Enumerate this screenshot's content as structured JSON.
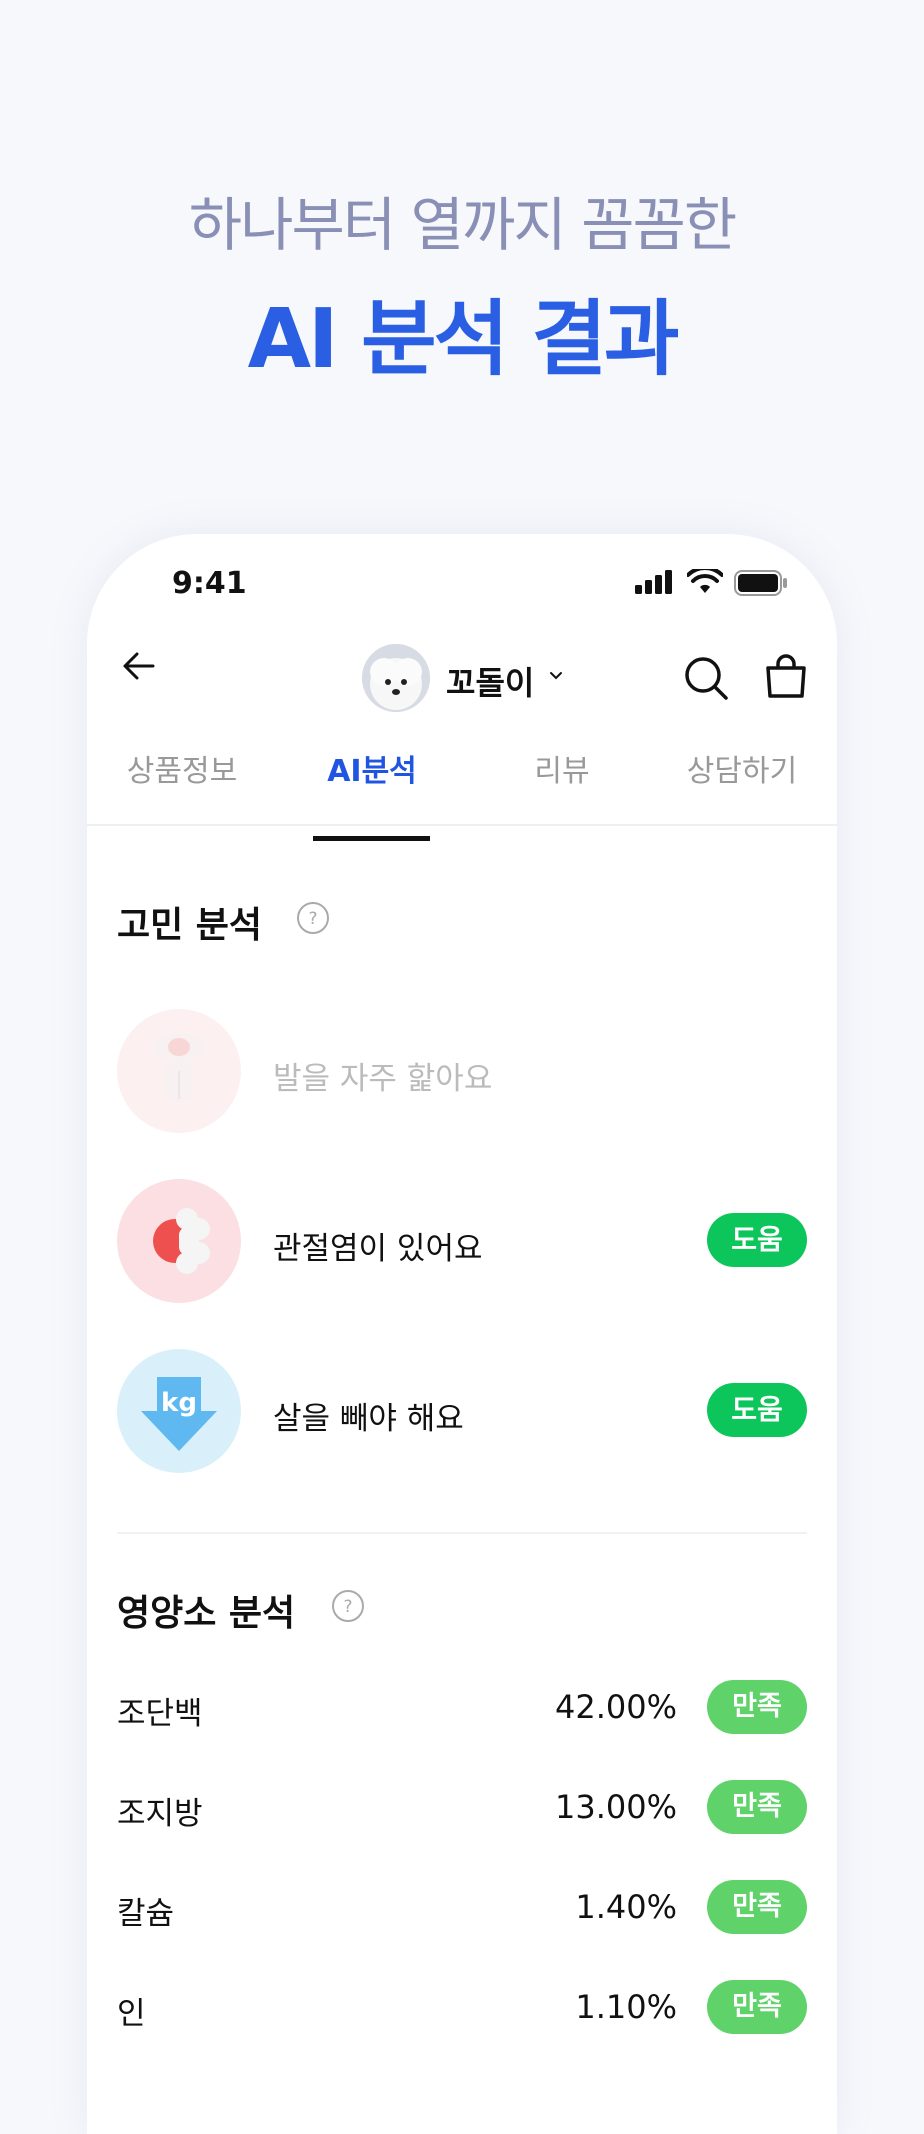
{
  "promo": {
    "line1": "하나부터 열까지 꼼꼼한",
    "line2": "AI 분석 결과"
  },
  "status_bar": {
    "time": "9:41"
  },
  "header": {
    "pet_name": "꼬돌이"
  },
  "tabs": [
    {
      "label": "상품정보",
      "active": false
    },
    {
      "label": "AI분석",
      "active": true
    },
    {
      "label": "리뷰",
      "active": false
    },
    {
      "label": "상담하기",
      "active": false
    }
  ],
  "concerns": {
    "title": "고민 분석",
    "items": [
      {
        "label": "발을 자주 핥아요",
        "icon": "paw-licking-icon",
        "dimmed": true,
        "badge": ""
      },
      {
        "label": "관절염이 있어요",
        "icon": "joint-bone-icon",
        "dimmed": false,
        "badge": "도움"
      },
      {
        "label": "살을 빼야 해요",
        "icon": "weight-loss-kg-icon",
        "icon_text": "kg",
        "dimmed": false,
        "badge": "도움"
      }
    ]
  },
  "nutrients": {
    "title": "영양소 분석",
    "items": [
      {
        "name": "조단백",
        "value": "42.00%",
        "badge": "만족"
      },
      {
        "name": "조지방",
        "value": "13.00%",
        "badge": "만족"
      },
      {
        "name": "칼슘",
        "value": "1.40%",
        "badge": "만족"
      },
      {
        "name": "인",
        "value": "1.10%",
        "badge": "만족"
      }
    ]
  },
  "colors": {
    "accent": "#1f55e0",
    "help_badge": "#0dc65b",
    "ok_badge": "#5fd26a"
  }
}
